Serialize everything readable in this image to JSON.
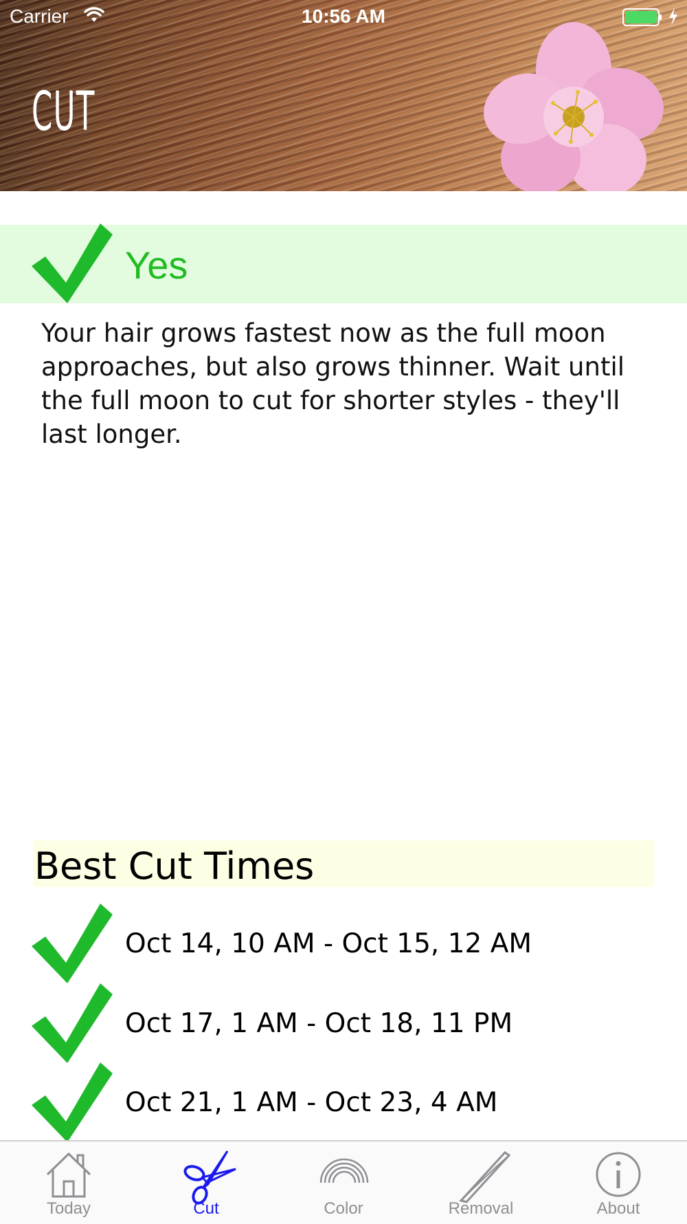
{
  "status_bar": {
    "carrier": "Carrier",
    "time": "10:56 AM"
  },
  "header": {
    "title": "CUT"
  },
  "verdict": {
    "label": "Yes",
    "color": "#22bb22",
    "background": "#e3fce0"
  },
  "advice": "Your hair grows fastest now as the full moon approaches, but also grows thinner. Wait until the full moon to cut for shorter styles - they'll last longer.",
  "best_times": {
    "title": "Best Cut Times",
    "items": [
      {
        "label": "Oct 14, 10 AM - Oct 15, 12 AM"
      },
      {
        "label": "Oct 17, 1 AM - Oct 18, 11 PM"
      },
      {
        "label": "Oct 21, 1 AM - Oct 23, 4 AM"
      }
    ]
  },
  "tabs": [
    {
      "label": "Today",
      "icon": "house-icon"
    },
    {
      "label": "Cut",
      "icon": "scissors-icon",
      "active": true
    },
    {
      "label": "Color",
      "icon": "rainbow-icon"
    },
    {
      "label": "Removal",
      "icon": "tweezers-icon"
    },
    {
      "label": "About",
      "icon": "info-icon"
    }
  ],
  "colors": {
    "accent": "#1a1aee",
    "check": "#1fb92c"
  }
}
